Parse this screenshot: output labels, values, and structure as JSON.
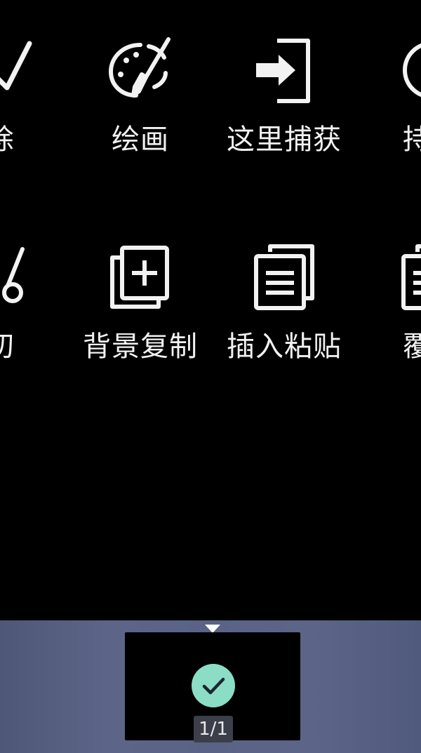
{
  "tools_row1": [
    {
      "label": "除",
      "icon": "check-icon"
    },
    {
      "label": "绘画",
      "icon": "palette-brush-icon"
    },
    {
      "label": "这里捕获",
      "icon": "capture-here-icon"
    },
    {
      "label": "持续",
      "icon": "continuous-capture-icon"
    }
  ],
  "tools_row2": [
    {
      "label": "切",
      "icon": "scissors-icon"
    },
    {
      "label": "背景复制",
      "icon": "background-copy-icon"
    },
    {
      "label": "插入粘贴",
      "icon": "insert-paste-icon"
    },
    {
      "label": "覆盖",
      "icon": "overlay-paste-icon"
    }
  ],
  "thumbnail_tray": {
    "page_count": "1/1",
    "selected": true,
    "accent": "#8cddc6",
    "tray_color": "#5a6386"
  }
}
